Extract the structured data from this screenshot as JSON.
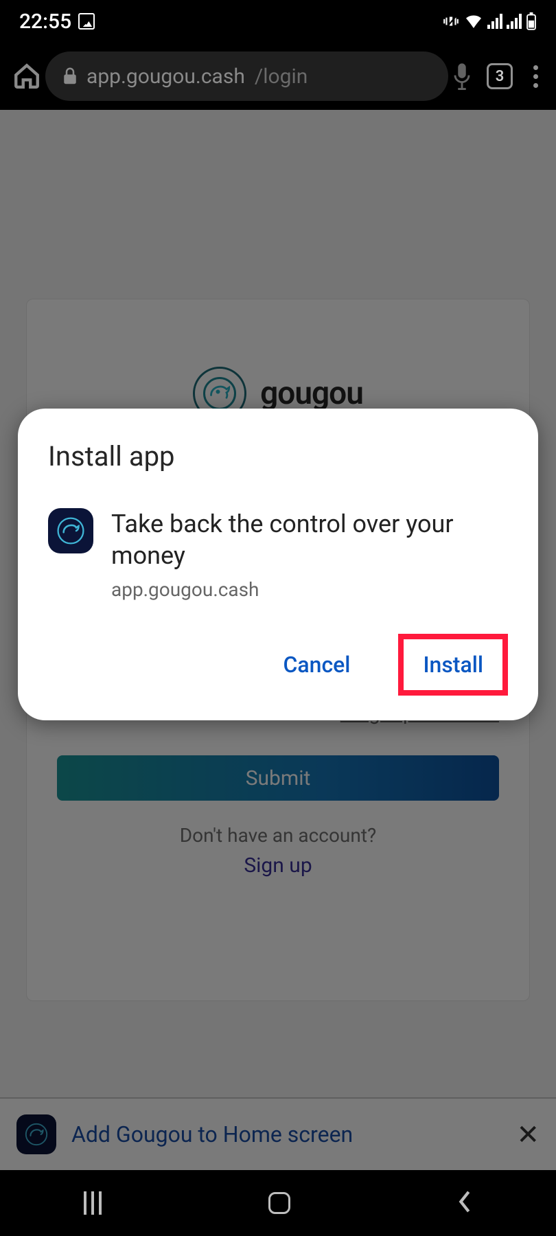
{
  "status": {
    "time": "22:55",
    "tab_count": "3"
  },
  "address_bar": {
    "host": "app.gougou.cash",
    "path": "/login"
  },
  "page": {
    "brand_name": "gougou",
    "forgot_password": "Forgot password?",
    "submit": "Submit",
    "no_account": "Don't have an account?",
    "sign_up": "Sign up"
  },
  "a2h_banner": {
    "text": "Add Gougou to Home screen"
  },
  "dialog": {
    "title": "Install app",
    "message": "Take back the control over your money",
    "url": "app.gougou.cash",
    "cancel": "Cancel",
    "install": "Install"
  }
}
